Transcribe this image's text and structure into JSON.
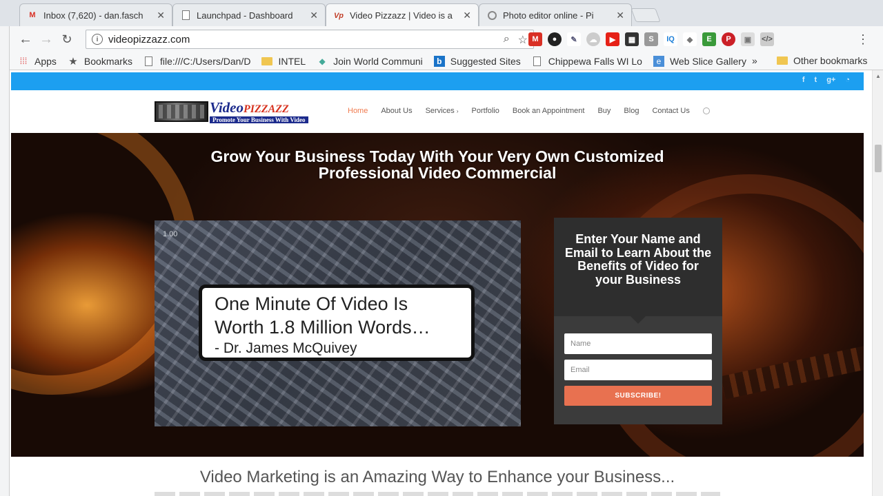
{
  "tabs": [
    {
      "title": "Inbox (7,620) - dan.fasch",
      "icon": "gmail-icon"
    },
    {
      "title": "Launchpad - Dashboard",
      "icon": "page-icon"
    },
    {
      "title": "Video Pizzazz | Video is a",
      "icon": "vp-icon",
      "active": true
    },
    {
      "title": "Photo editor online - Pi",
      "icon": "globe-icon"
    }
  ],
  "toolbar": {
    "url": "videopizzazz.com"
  },
  "bookmarks": {
    "items": [
      "Apps",
      "Bookmarks",
      "file:///C:/Users/Dan/D",
      "INTEL",
      "Join World Communi",
      "Suggested Sites",
      "Chippewa Falls WI Lo",
      "Web Slice Gallery"
    ],
    "more": "»",
    "other": "Other bookmarks"
  },
  "site": {
    "logo": {
      "brand_a": "Video",
      "brand_b": "PIZZAZZ",
      "tagline": "Promote Your Business With Video"
    },
    "nav": [
      "Home",
      "About Us",
      "Services",
      "Portfolio",
      "Book an Appointment",
      "Buy",
      "Blog",
      "Contact Us"
    ],
    "headline_1": "Grow Your Business Today With Your Very Own Customized",
    "headline_2": "Professional Video Commercial",
    "video": {
      "badge": "1.00",
      "quote_1": "One Minute Of Video Is",
      "quote_2": "Worth 1.8 Million Words…",
      "quote_3": "- Dr. James McQuivey"
    },
    "form": {
      "heading": "Enter Your Name and Email to Learn About the Benefits of Video for your Business",
      "name_placeholder": "Name",
      "email_placeholder": "Email",
      "button": "SUBSCRIBE!"
    },
    "section_heading": "Video Marketing is an Amazing Way to Enhance your Business..."
  },
  "colors": {
    "topbar": "#1c9ff0",
    "accent": "#e87150",
    "nav_active": "#f07b4f"
  }
}
